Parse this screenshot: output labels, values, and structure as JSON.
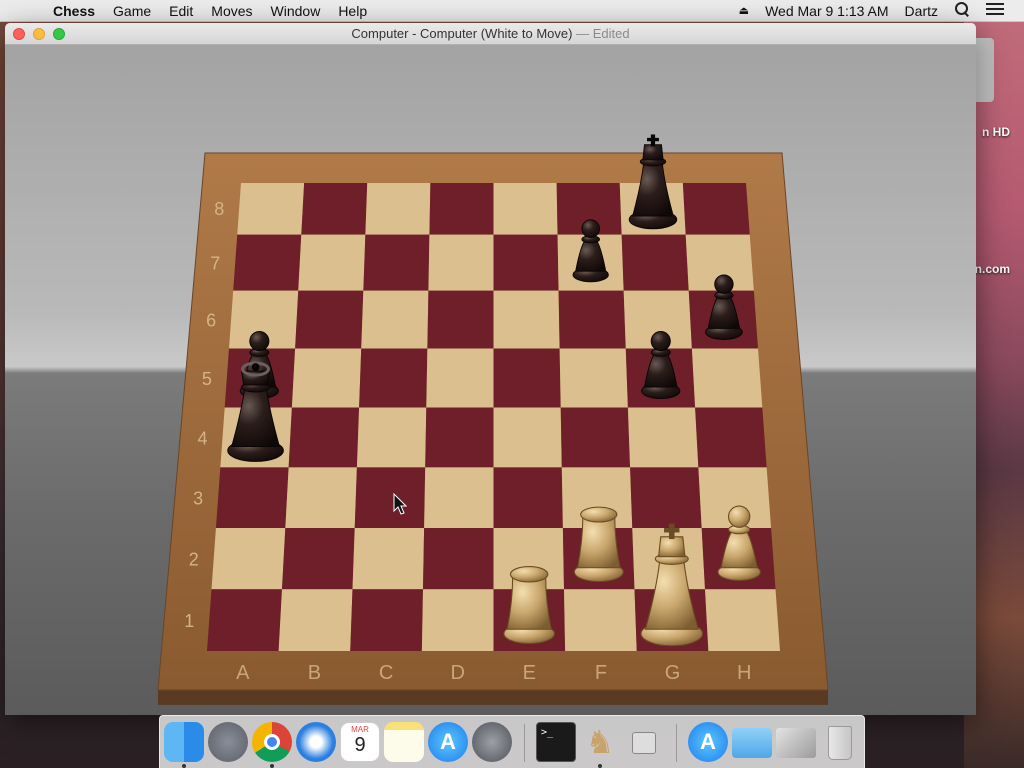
{
  "menubar": {
    "app_name": "Chess",
    "menus": [
      "Game",
      "Edit",
      "Moves",
      "Window",
      "Help"
    ],
    "clock": "Wed Mar 9  1:13 AM",
    "user": "Dartz"
  },
  "window": {
    "title": "Computer - Computer   (White to Move)",
    "edited_suffix": " — Edited"
  },
  "desktop": {
    "labels": [
      "n HD",
      "n.com"
    ]
  },
  "board": {
    "files": [
      "A",
      "B",
      "C",
      "D",
      "E",
      "F",
      "G",
      "H"
    ],
    "ranks": [
      "1",
      "2",
      "3",
      "4",
      "5",
      "6",
      "7",
      "8"
    ],
    "light_color": "#dcbf8e",
    "dark_color": "#6e1f2a",
    "frame_color": "#9c6a3f",
    "pieces": [
      {
        "color": "black",
        "type": "king",
        "square": "g8"
      },
      {
        "color": "black",
        "type": "pawn",
        "square": "f7"
      },
      {
        "color": "black",
        "type": "pawn",
        "square": "h6"
      },
      {
        "color": "black",
        "type": "pawn",
        "square": "g5"
      },
      {
        "color": "black",
        "type": "pawn",
        "square": "a5"
      },
      {
        "color": "black",
        "type": "queen",
        "square": "a4"
      },
      {
        "color": "white",
        "type": "rook",
        "square": "f2"
      },
      {
        "color": "white",
        "type": "pawn",
        "square": "h2"
      },
      {
        "color": "white",
        "type": "rook",
        "square": "e1"
      },
      {
        "color": "white",
        "type": "king",
        "square": "g1"
      }
    ]
  },
  "dock": {
    "apps": [
      "finder",
      "launchpad",
      "chrome",
      "safari",
      "calendar",
      "notes",
      "app-store",
      "system-preferences",
      "terminal",
      "chess",
      "archive-utility",
      "app-store-folder",
      "folder",
      "screenshots",
      "trash"
    ],
    "calendar_month": "MAR",
    "calendar_day": "9"
  }
}
